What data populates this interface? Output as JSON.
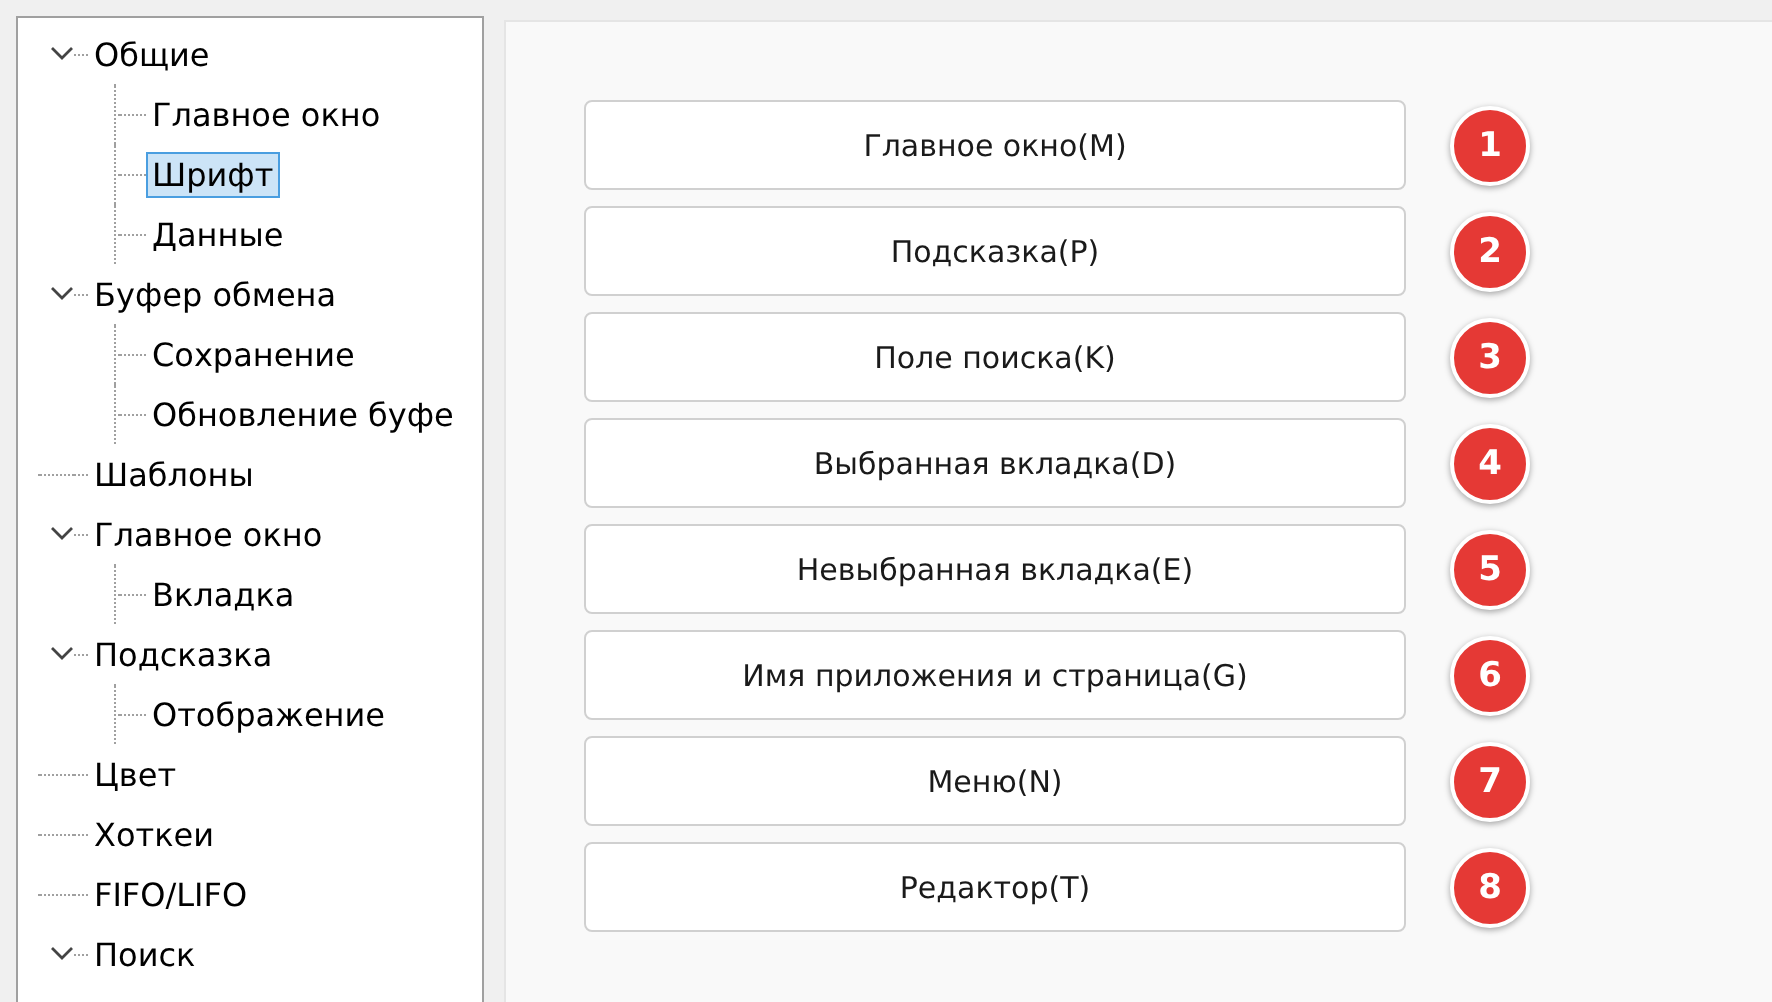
{
  "tree": [
    {
      "label": "Общие",
      "expanded": true,
      "selected": false,
      "children": [
        {
          "label": "Главное окно",
          "selected": false
        },
        {
          "label": "Шрифт",
          "selected": true
        },
        {
          "label": "Данные",
          "selected": false
        }
      ]
    },
    {
      "label": "Буфер обмена",
      "expanded": true,
      "selected": false,
      "children": [
        {
          "label": "Сохранение",
          "selected": false
        },
        {
          "label": "Обновление буфе",
          "selected": false
        }
      ]
    },
    {
      "label": "Шаблоны",
      "selected": false
    },
    {
      "label": "Главное окно",
      "expanded": true,
      "selected": false,
      "children": [
        {
          "label": "Вкладка",
          "selected": false
        }
      ]
    },
    {
      "label": "Подсказка",
      "expanded": true,
      "selected": false,
      "children": [
        {
          "label": "Отображение",
          "selected": false
        }
      ]
    },
    {
      "label": "Цвет",
      "selected": false
    },
    {
      "label": "Хоткеи",
      "selected": false
    },
    {
      "label": "FIFO/LIFO",
      "selected": false
    },
    {
      "label": "Поиск",
      "expanded": true,
      "selected": false
    }
  ],
  "font_buttons": [
    {
      "label": "Главное окно(M)",
      "badge": "1"
    },
    {
      "label": "Подсказка(P)",
      "badge": "2"
    },
    {
      "label": "Поле поиска(K)",
      "badge": "3"
    },
    {
      "label": "Выбранная вкладка(D)",
      "badge": "4"
    },
    {
      "label": "Невыбранная вкладка(E)",
      "badge": "5"
    },
    {
      "label": "Имя приложения и страница(G)",
      "badge": "6"
    },
    {
      "label": "Меню(N)",
      "badge": "7"
    },
    {
      "label": "Редактор(T)",
      "badge": "8"
    }
  ]
}
